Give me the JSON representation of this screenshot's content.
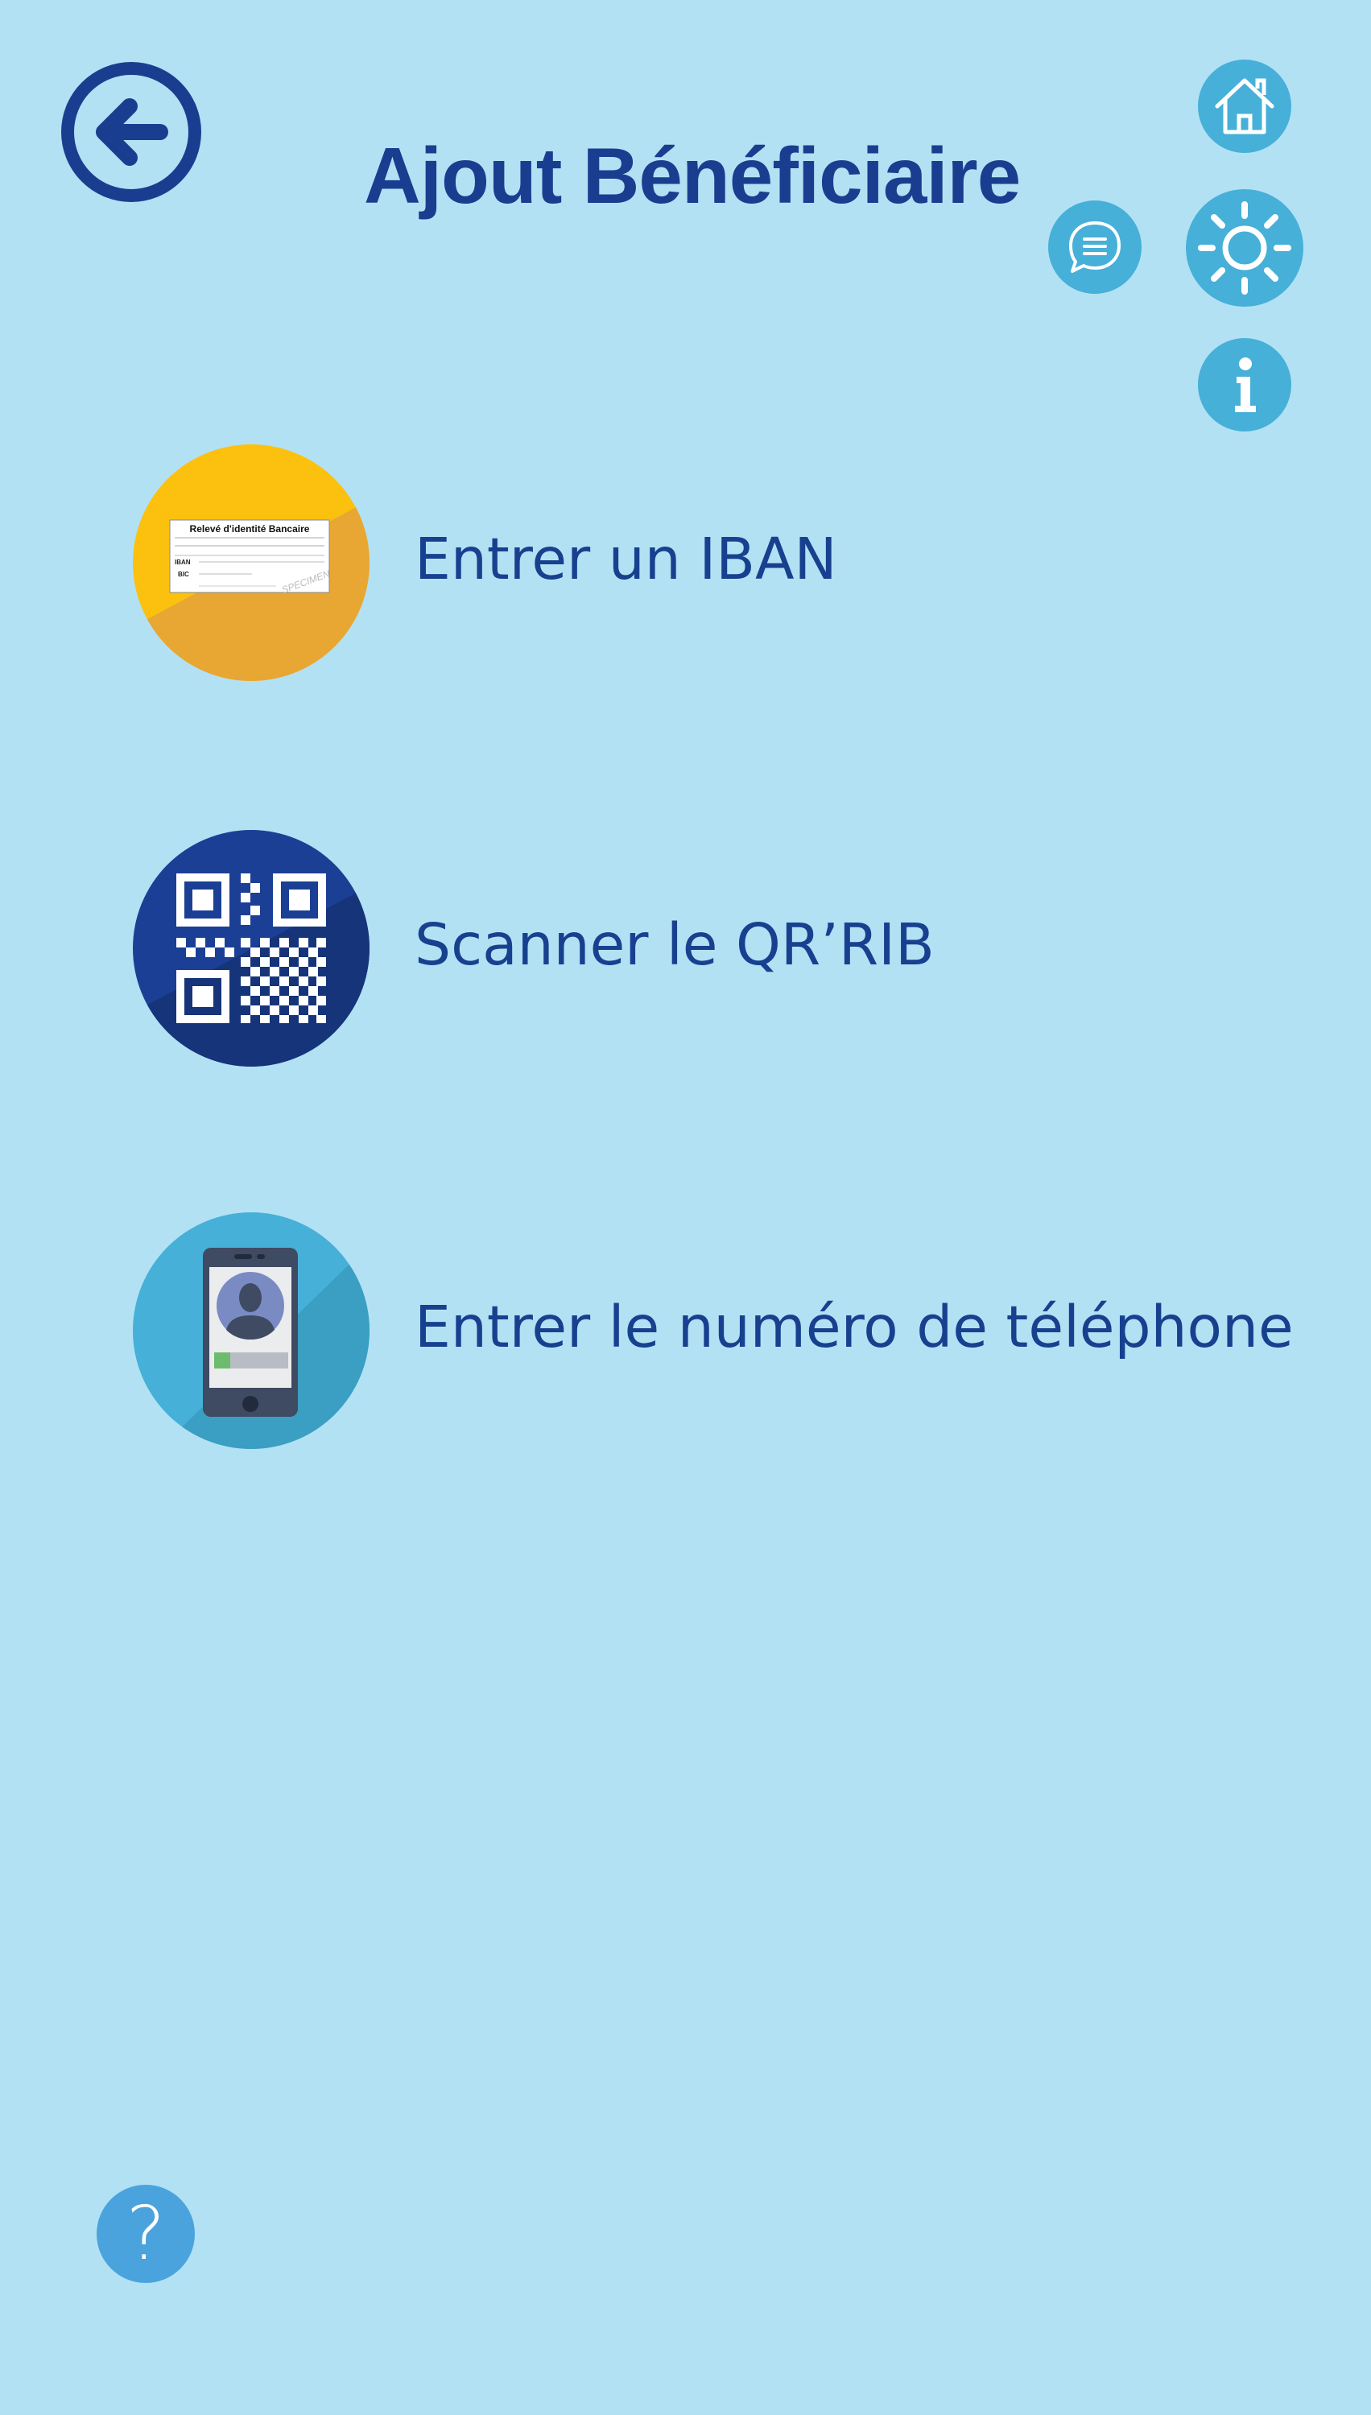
{
  "header": {
    "title": "Ajout Bénéficiaire"
  },
  "nav": {
    "back_icon": "arrow-left-circle-icon",
    "home_icon": "home-icon",
    "chat_icon": "chat-bubble-icon",
    "theme_icon": "sun-icon",
    "info_icon": "info-icon",
    "help_icon": "question-icon"
  },
  "options": [
    {
      "label": "Entrer un IBAN",
      "icon": "bank-document-icon"
    },
    {
      "label": "Scanner le QR’RIB",
      "icon": "qr-code-icon"
    },
    {
      "label": "Entrer le numéro de téléphone",
      "icon": "phone-contact-icon"
    }
  ],
  "rib_card": {
    "title": "Relevé d'identité Bancaire",
    "iban_label": "IBAN",
    "bic_label": "BIC",
    "stamp": "SPECIMEN"
  },
  "help": {
    "glyph": "?"
  },
  "colors": {
    "background": "#b3e1f4",
    "title": "#1a3e8f",
    "accent": "#46b0d8",
    "option_text": "#17418f"
  }
}
